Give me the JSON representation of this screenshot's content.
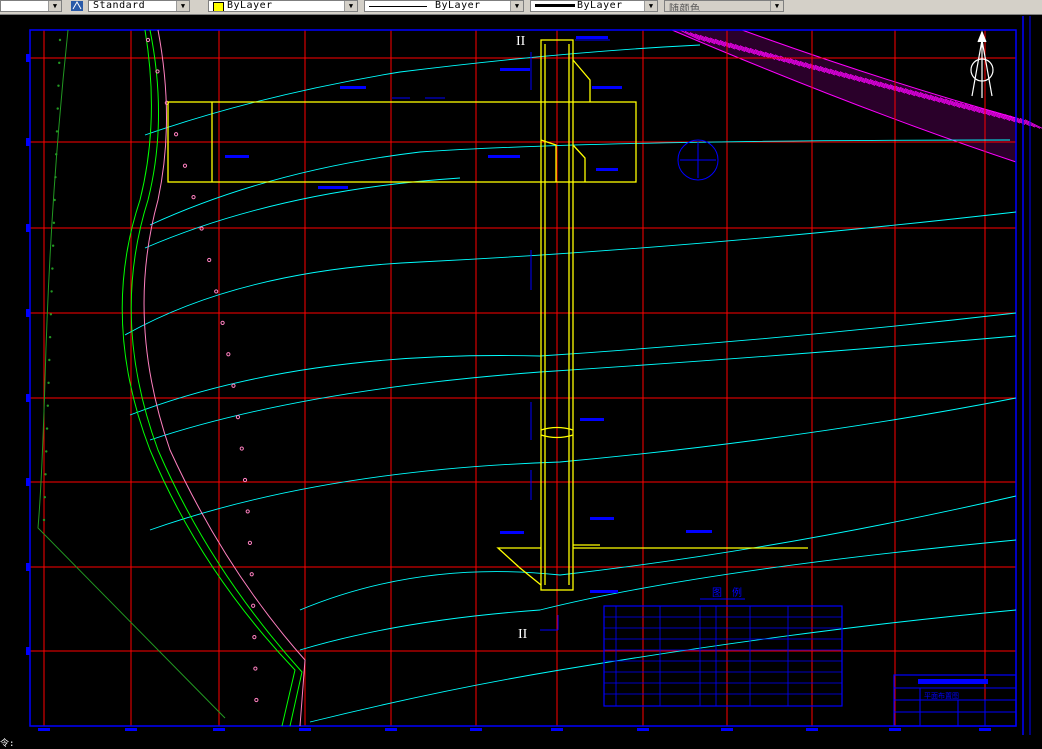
{
  "toolbar": {
    "text_style": "Standard",
    "layer_color": "ByLayer",
    "linetype": "ByLayer",
    "lineweight": "ByLayer",
    "plot_style": "随颜色"
  },
  "drawing": {
    "section_mark_top": "II",
    "section_mark_bottom": "II",
    "legend_title": "图　例",
    "title_block_name": "平面布置图"
  },
  "statusbar": {
    "prompt": "令:"
  },
  "colors": {
    "grid": "#ff0000",
    "frame": "#0000ff",
    "contour": "#00ffff",
    "structure": "#ffff00",
    "road_green": "#00ff00",
    "boundary_pink": "#ff80c0",
    "hatch": "#ff00ff"
  }
}
